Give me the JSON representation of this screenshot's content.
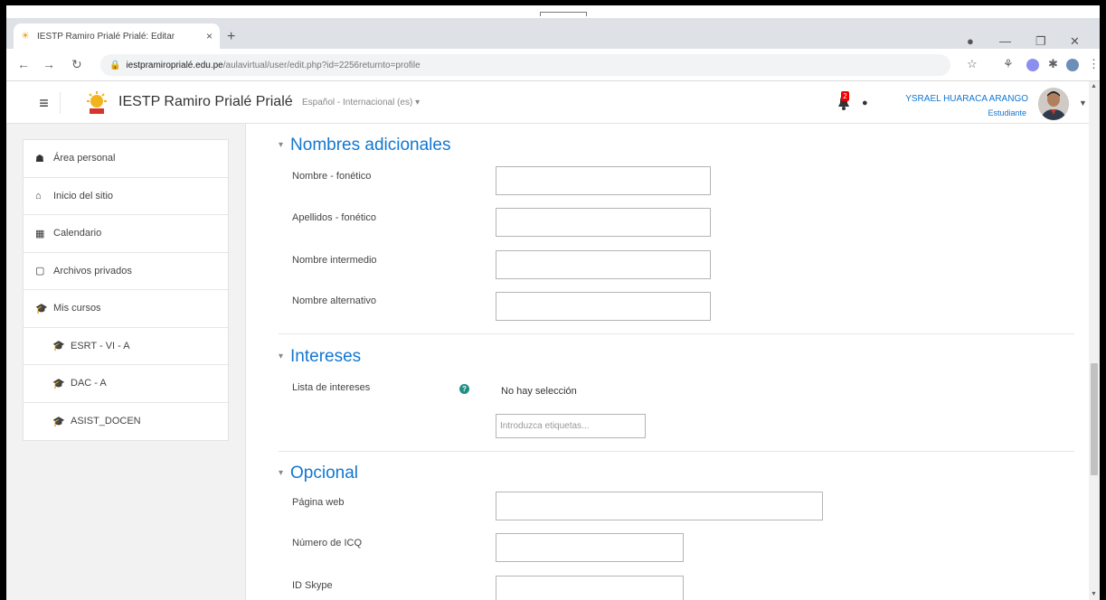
{
  "browser": {
    "tab_title": "IESTP Ramiro Prialé Prialé: Editar",
    "tab_close": "×",
    "new_tab": "+",
    "url_host": "iestpramiroprialé.edu.pe",
    "url_path": "/aulavirtual/user/edit.php?id=2256returnto=profile"
  },
  "navbar": {
    "menu_glyph": "≡",
    "site_name": "IESTP Ramiro Prialé Prialé",
    "language": "Español - Internacional (es) ▾",
    "notification_count": "2",
    "user_name": "YSRAEL HUARACA ARANGO",
    "user_role": "Estudiante"
  },
  "sidebar": {
    "items": [
      {
        "icon": "dashboard-icon",
        "glyph": "☗",
        "label": "Área personal"
      },
      {
        "icon": "home-icon",
        "glyph": "⌂",
        "label": "Inicio del sitio"
      },
      {
        "icon": "calendar-icon",
        "glyph": "▦",
        "label": "Calendario"
      },
      {
        "icon": "file-icon",
        "glyph": "▢",
        "label": "Archivos privados"
      },
      {
        "icon": "graduation-cap-icon",
        "glyph": "🎓",
        "label": "Mis cursos"
      },
      {
        "icon": "graduation-cap-icon",
        "glyph": "🎓",
        "label": "ESRT - VI - A"
      },
      {
        "icon": "graduation-cap-icon",
        "glyph": "🎓",
        "label": "DAC - A"
      },
      {
        "icon": "graduation-cap-icon",
        "glyph": "🎓",
        "label": "ASIST_DOCEN"
      }
    ]
  },
  "sections": {
    "nombres": {
      "title": "Nombres adicionales",
      "fields": [
        "Nombre - fonético",
        "Apellidos - fonético",
        "Nombre intermedio",
        "Nombre alternativo"
      ]
    },
    "intereses": {
      "title": "Intereses",
      "label": "Lista de intereses",
      "no_selection": "No hay selección",
      "tags_placeholder": "Introduzca etiquetas..."
    },
    "opcional": {
      "title": "Opcional",
      "fields": [
        "Página web",
        "Número de ICQ",
        "ID Skype"
      ]
    }
  },
  "colors": {
    "accent": "#1177d1",
    "help": "#1f8f86",
    "badge": "#ee0000"
  }
}
